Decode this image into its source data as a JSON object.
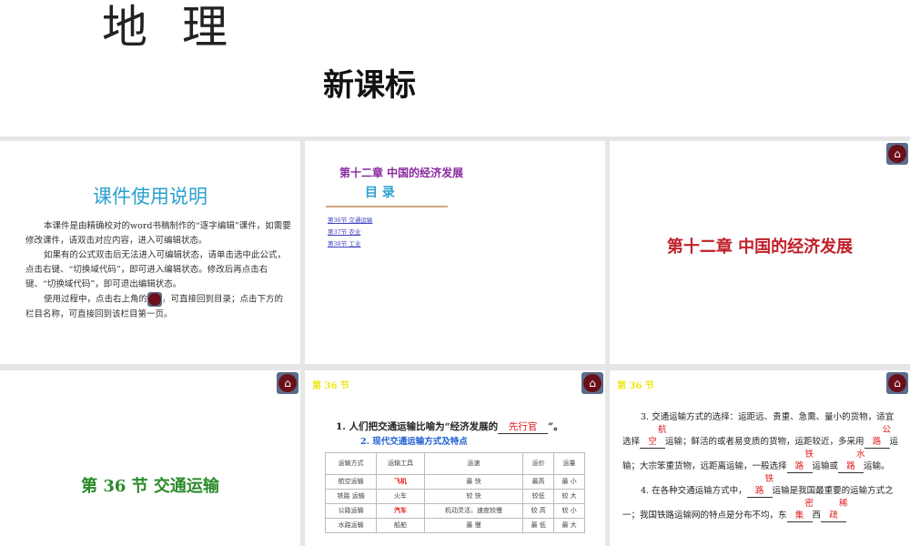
{
  "title": {
    "main": "地理",
    "sub": "新课标"
  },
  "s1": {
    "title": "课件使用说明",
    "lines": [
      "本课件是由精确校对的word书稿制作的“逐字编辑”课",
      "件，如需要修改课件，请双击对应内容，进入可编辑状态。",
      "如果有的公式双击后无法进入可编辑状态，请单击选中",
      "此公式，点击右键、“切换域代码”，即可进入编辑状态。",
      "修改后再点击右键、“切换域代码”，即可退出编辑状态。",
      "使用过程中，点击右上角的",
      "，可直接回到目录；",
      "点击下方的栏目名称，可直接回到该栏目第一页。"
    ]
  },
  "s2": {
    "chapter": "第十二章  中国的经济发展",
    "toc": "目  录",
    "links": [
      "第36节  交通运输",
      "第37节  农业",
      "第38节  工业"
    ]
  },
  "s3": {
    "title": "第十二章  中国的经济发展"
  },
  "s4": {
    "title": "第 36 节   交通运输"
  },
  "s5": {
    "section": "第 36 节",
    "q1": "1. 人们把交通运输比喻为“经济发展的",
    "a1": "先行官",
    "q1end": "”。",
    "q2": "2.  现代交通运输方式及特点",
    "headers": [
      "运输方式",
      "运输工具",
      "运速",
      "运价",
      "运量"
    ],
    "rows": [
      [
        "航空运输",
        "飞机",
        "最 快",
        "最高",
        "最 小"
      ],
      [
        "铁路 运输",
        "火车",
        "较 快",
        "较低",
        "较 大"
      ],
      [
        "公路运输",
        "汽车",
        "机动灵活，速度较慢",
        "较 高",
        "较 小"
      ],
      [
        "水路运输",
        "船舶",
        "最 慢",
        "最 低",
        "最 大"
      ]
    ]
  },
  "s6": {
    "section": "第 36 节",
    "p3a": "3. 交通运输方式的选择：运距远、贵重、急需、量小的货物，适宜选择",
    "b1": "航空",
    "p3b": "运输；鲜活的或者易变质的货物，运距较近，多采用",
    "b2": "公路",
    "p3c": "运输；大宗笨重货物，远距离运输，一般选择",
    "b3": "铁路",
    "p3d": "运输或",
    "b4": "水路",
    "p3e": "运输。",
    "p4a": "4. 在各种交通运输方式中，",
    "b5": "铁路",
    "p4b": "运输是我国最重要的运输方式之一；我国铁路运输网的特点是分布不均，东",
    "b6": "密集",
    "p4c": "西",
    "b7": "稀疏"
  }
}
